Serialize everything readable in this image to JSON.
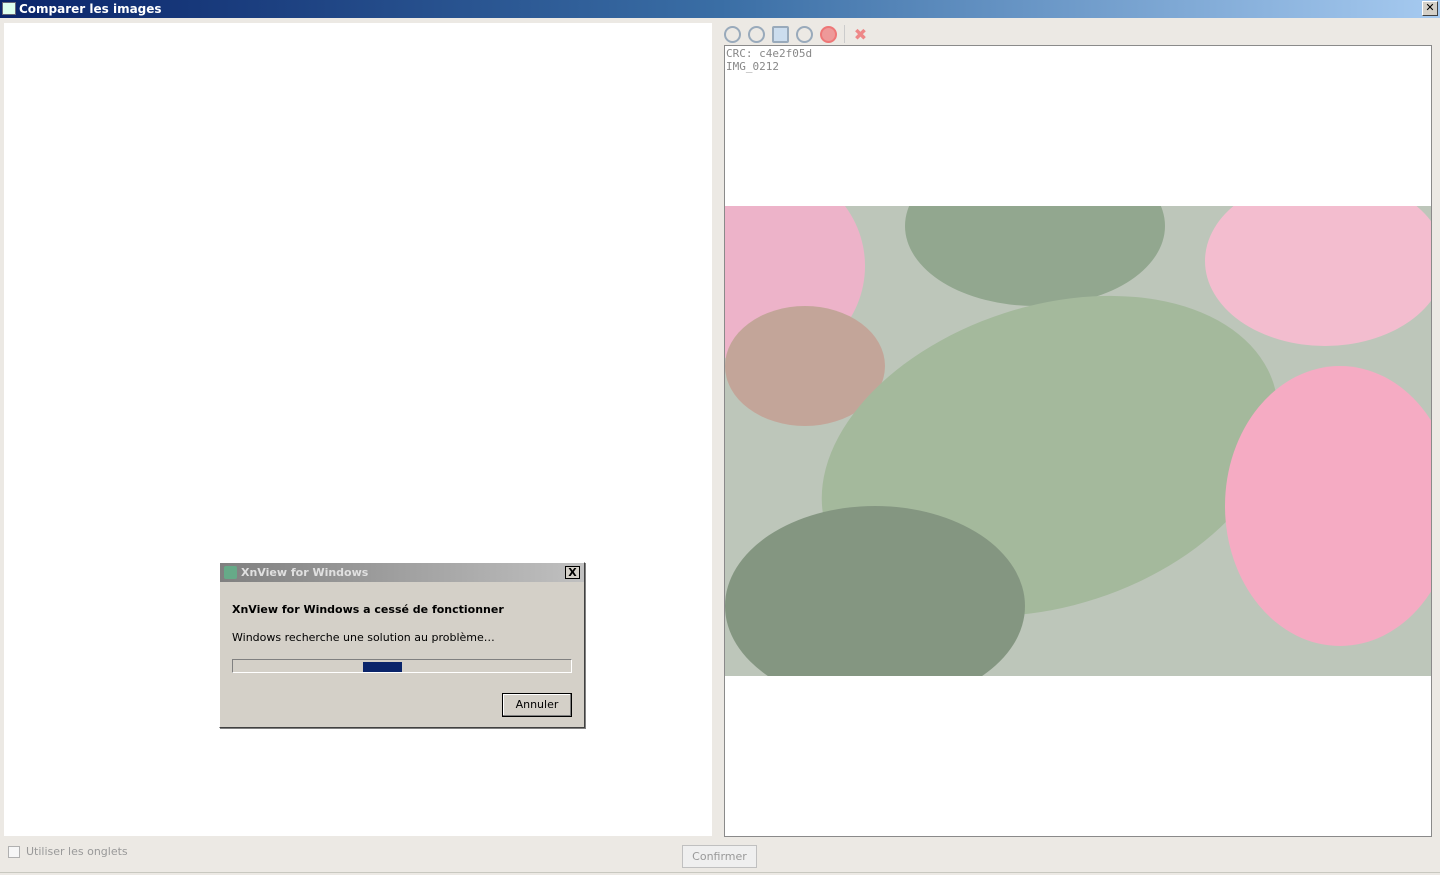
{
  "window": {
    "title": "Comparer les images",
    "close": "✕"
  },
  "toolbar": {
    "icons": [
      "zoom-in-icon",
      "zoom-out-icon",
      "fit-icon",
      "zoom-icon",
      "stop-icon",
      "delete-icon"
    ]
  },
  "viewer": {
    "crc": "CRC: c4e2f05d",
    "filename": "IMG_0212"
  },
  "dialog": {
    "title": "XnView for Windows",
    "close": "X",
    "heading": "XnView for Windows a cessé de fonctionner",
    "message": "Windows recherche une solution au problème…",
    "cancel": "Annuler"
  },
  "footer": {
    "tabs_checkbox": "Utiliser les onglets",
    "tabs_checked": false,
    "confirm": "Confirmer"
  },
  "colors": {
    "title_start": "#0a246a",
    "progress": "#0a246a"
  }
}
